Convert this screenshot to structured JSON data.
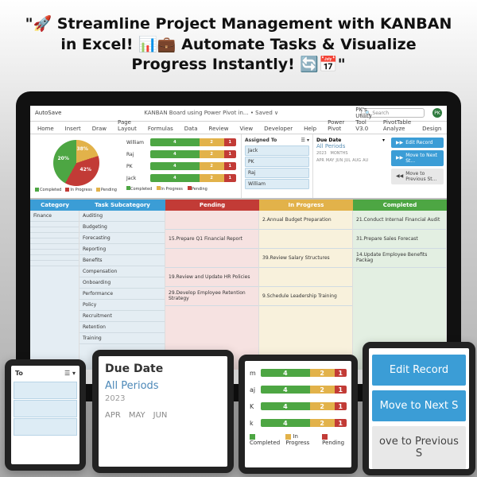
{
  "headline": "\"🚀 Streamline Project Management with KANBAN in Excel! 📊💼 Automate Tasks & Visualize Progress Instantly! 🔄📅\"",
  "ribbon": {
    "autosave": "AutoSave",
    "title": "KANBAN Board using Power Pivot in... • Saved ∨",
    "search_placeholder": "Search",
    "user": "PK",
    "tabs": [
      "Home",
      "Insert",
      "Draw",
      "Page Layout",
      "Formulas",
      "Data",
      "Review",
      "View",
      "Developer",
      "Help",
      "Power Pivot",
      "PK's Utility Tool V3.0",
      "PivotTable Analyze",
      "Design"
    ]
  },
  "chart_data": {
    "pie": {
      "type": "pie",
      "slices": [
        {
          "label": "Completed",
          "value": 42,
          "color": "#4da643"
        },
        {
          "label": "In Progress",
          "value": 38,
          "color": "#c23b36"
        },
        {
          "label": "Pending",
          "value": 20,
          "color": "#e2b24a"
        }
      ],
      "legend": [
        "Completed",
        "In Progress",
        "Pending"
      ]
    },
    "stacked_bars": {
      "type": "bar",
      "categories": [
        "William",
        "Raj",
        "PK",
        "Jack"
      ],
      "series": [
        {
          "name": "Completed",
          "color": "#4da643",
          "values": [
            4,
            4,
            4,
            4
          ]
        },
        {
          "name": "In Progress",
          "color": "#e2b24a",
          "values": [
            2,
            2,
            2,
            2
          ]
        },
        {
          "name": "Pending",
          "color": "#c23b36",
          "values": [
            1,
            1,
            1,
            1
          ]
        }
      ],
      "legend": [
        "Completed",
        "In Progress",
        "Pending"
      ]
    }
  },
  "filters": {
    "assigned_label": "Assigned To",
    "options": [
      "Jack",
      "PK",
      "Raj",
      "William"
    ]
  },
  "due_date": {
    "label": "Due Date",
    "all": "All Periods",
    "year": "2023",
    "months_tag": "MONTHS",
    "months": [
      "APR",
      "MAY",
      "JUN",
      "JUL",
      "AUG",
      "AU"
    ]
  },
  "buttons": {
    "edit": "Edit Record",
    "next": "Move to Next St...",
    "prev": "Move to Previous St..."
  },
  "kanban": {
    "headers": [
      "Category",
      "Task Subcategory",
      "Pending",
      "In Progress",
      "Completed"
    ],
    "cats": [
      "Finance",
      "",
      "",
      "",
      "",
      "",
      "",
      "",
      ""
    ],
    "subcats": [
      "Auditing",
      "Budgeting",
      "Forecasting",
      "Reporting",
      "Benefits",
      "Compensation",
      "Onboarding",
      "Performance",
      "Policy",
      "Recruitment",
      "Retention",
      "Training"
    ],
    "pending": [
      "",
      "15.Prepare Q1 Financial Report",
      "",
      "19.Review and Update HR Policies",
      "29.Develop Employee Retention Strategy"
    ],
    "inprogress": [
      "2.Annual Budget Preparation",
      "",
      "39.Review Salary Structures",
      "",
      "9.Schedule Leadership Training"
    ],
    "completed": [
      "21.Conduct Internal Financial Audit",
      "31.Prepare Sales Forecast",
      "14.Update Employee Benefits Packag"
    ]
  },
  "overlay_filter": {
    "label": "To"
  },
  "overlay_date": {
    "title": "Due Date",
    "all": "All Periods",
    "year": "2023",
    "months": [
      "APR",
      "MAY",
      "JUN"
    ]
  },
  "overlay_bars_labels": [
    "m",
    "aj",
    "K",
    "k"
  ],
  "overlay_btns": {
    "edit": "Edit Record",
    "next": "Move to Next S",
    "prev": "ove to Previous S"
  }
}
